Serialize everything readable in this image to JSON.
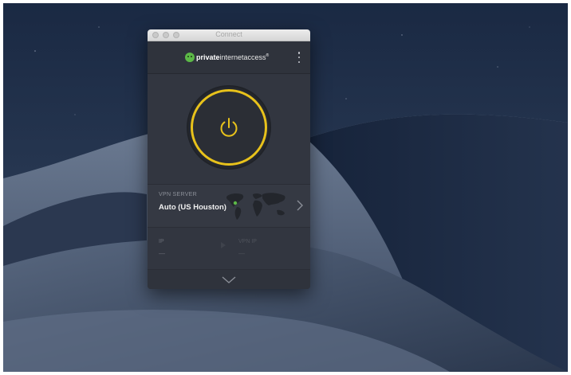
{
  "window": {
    "title": "Connect"
  },
  "header": {
    "logo_bold": "private",
    "logo_light": "internetaccess",
    "logo_mark": "®",
    "menu_icon": "vertical-dots-icon"
  },
  "connect": {
    "state": "disconnected",
    "power_icon": "power-icon",
    "ring_color": "#e8c21b"
  },
  "server": {
    "label": "VPN SERVER",
    "value": "Auto (US Houston)",
    "map_icon": "world-map-icon",
    "location_color": "#5cb947"
  },
  "ip": {
    "label": "IP",
    "value": "—",
    "vpn_label": "VPN IP",
    "vpn_value": "—"
  },
  "footer": {
    "expand_icon": "chevron-down-icon"
  },
  "colors": {
    "accent": "#e8c21b",
    "brand_green": "#5cb947",
    "panel": "#323640"
  }
}
